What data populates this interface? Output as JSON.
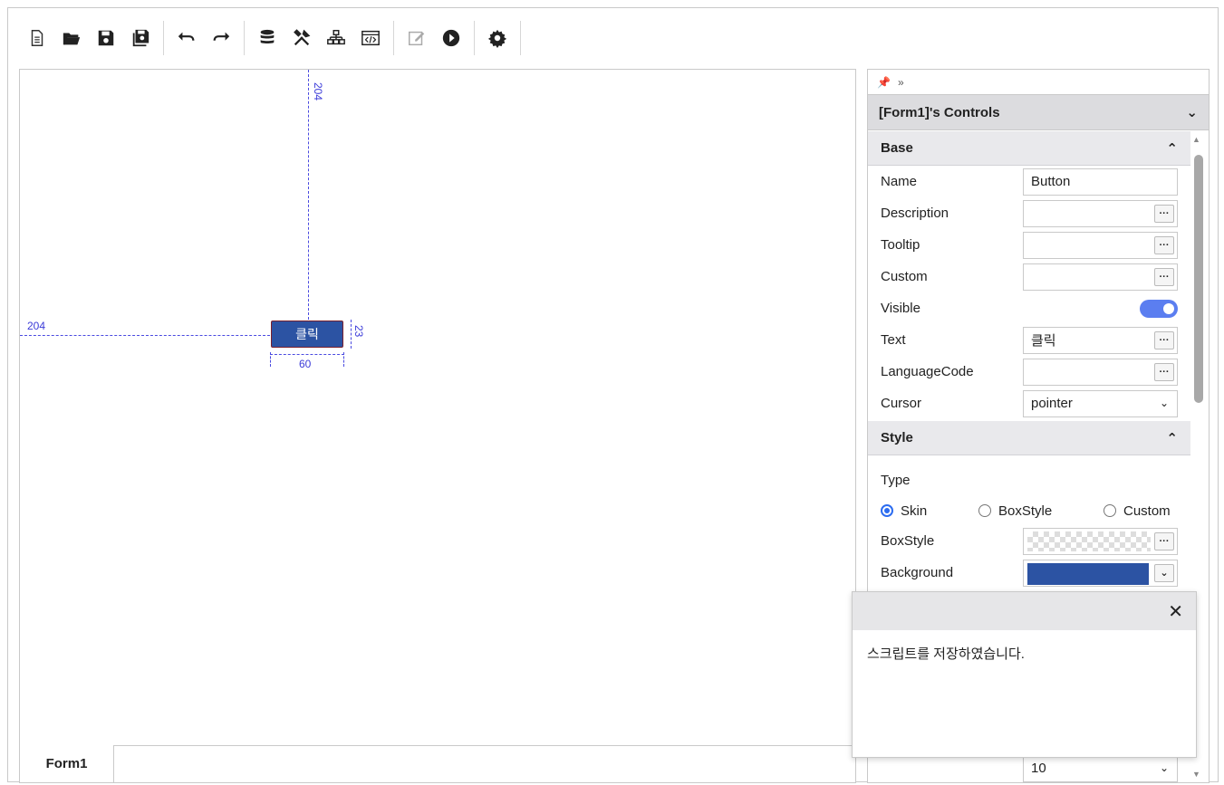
{
  "toolbar": {
    "icons": [
      "new-file-icon",
      "open-folder-icon",
      "save-icon",
      "save-all-icon",
      "undo-icon",
      "redo-icon",
      "database-icon",
      "tools-icon",
      "hierarchy-icon",
      "code-icon",
      "edit-icon",
      "play-icon",
      "settings-icon"
    ]
  },
  "canvas": {
    "guide_top": "204",
    "guide_left": "204",
    "height_dim": "23",
    "width_dim": "60",
    "button_text": "클릭",
    "tab_label": "Form1"
  },
  "panel": {
    "title": "[Form1]'s Controls",
    "section_base": "Base",
    "section_style": "Style",
    "props": {
      "name_label": "Name",
      "name_value": "Button",
      "description_label": "Description",
      "tooltip_label": "Tooltip",
      "custom_label": "Custom",
      "visible_label": "Visible",
      "text_label": "Text",
      "text_value": "클릭",
      "languagecode_label": "LanguageCode",
      "cursor_label": "Cursor",
      "cursor_value": "pointer",
      "type_label": "Type",
      "radio_skin": "Skin",
      "radio_boxstyle": "BoxStyle",
      "radio_custom": "Custom",
      "boxstyle_label": "BoxStyle",
      "background_label": "Background",
      "partial_value": "10"
    },
    "background_color": "#2c53a3"
  },
  "toast": {
    "message": "스크립트를 저장하였습니다."
  }
}
